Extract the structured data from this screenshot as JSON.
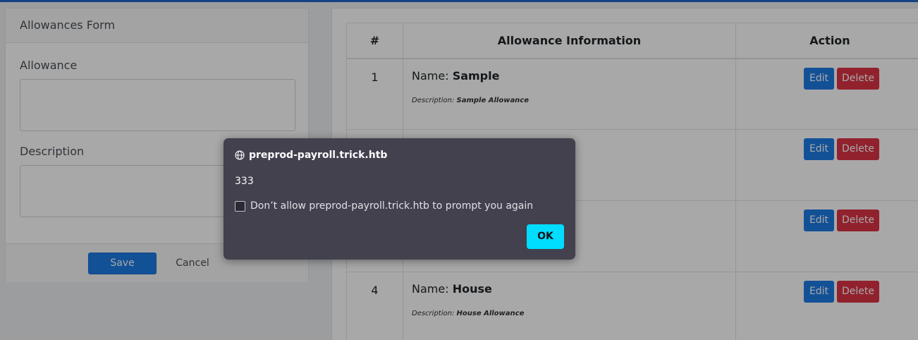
{
  "form": {
    "title": "Allowances Form",
    "allowance_label": "Allowance",
    "allowance_value": "",
    "description_label": "Description",
    "description_value": "",
    "save_label": "Save",
    "cancel_label": "Cancel"
  },
  "table": {
    "headers": [
      "#",
      "Allowance Information",
      "Action"
    ],
    "name_prefix": "Name: ",
    "desc_prefix": "Description: ",
    "edit_label": "Edit",
    "delete_label": "Delete",
    "rows": [
      {
        "num": "1",
        "name": "Sample",
        "description": "Sample Allowance"
      },
      {
        "num": "",
        "name": "",
        "description": ""
      },
      {
        "num": "",
        "name": "",
        "description": ""
      },
      {
        "num": "4",
        "name": "House",
        "description": "House Allowance"
      }
    ]
  },
  "dialog": {
    "origin": "preprod-payroll.trick.htb",
    "message": "333",
    "checkbox_label": "Don’t allow preprod-payroll.trick.htb to prompt you again",
    "checked": false,
    "ok_label": "OK"
  },
  "colors": {
    "primary": "#1e7be6",
    "danger": "#dc3545",
    "dialog_bg": "#42414d",
    "ok_button": "#00ddff"
  }
}
